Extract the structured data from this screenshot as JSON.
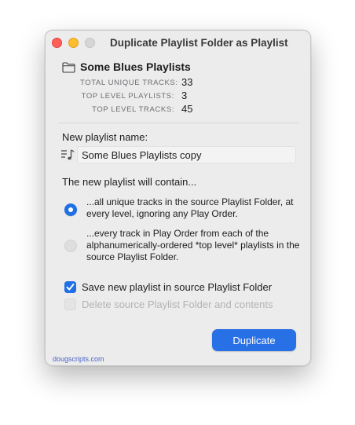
{
  "window": {
    "title": "Duplicate Playlist Folder as Playlist",
    "traffic_lights": {
      "close_color": "#ff5f57",
      "minimize_color": "#febc2e",
      "zoom_color": "#d6d6d6"
    }
  },
  "source_folder": {
    "icon": "folder-icon",
    "name": "Some Blues Playlists",
    "stats": [
      {
        "label": "TOTAL UNIQUE TRACKS:",
        "value": "33"
      },
      {
        "label": "TOP LEVEL PLAYLISTS:",
        "value": "3"
      },
      {
        "label": "TOP LEVEL TRACKS:",
        "value": "45"
      }
    ]
  },
  "new_playlist": {
    "label": "New playlist name:",
    "icon": "playlist-icon",
    "value": "Some Blues Playlists copy"
  },
  "contents": {
    "heading": "The new playlist will contain...",
    "options": [
      {
        "text": "...all unique tracks in the source Playlist Folder, at every level, ignoring any Play Order.",
        "selected": true
      },
      {
        "text": "...every track in Play Order from each of the alphanumerically-ordered *top level* playlists in the source Playlist Folder.",
        "selected": false
      }
    ]
  },
  "checkboxes": [
    {
      "label": "Save new playlist in source Playlist Folder",
      "checked": true,
      "enabled": true
    },
    {
      "label": "Delete source Playlist Folder and contents",
      "checked": false,
      "enabled": false
    }
  ],
  "actions": {
    "primary_label": "Duplicate"
  },
  "footer": {
    "link_text": "dougscripts.com"
  },
  "colors": {
    "accent": "#2870e6",
    "window_bg": "#ececec",
    "link": "#4a62c9"
  }
}
